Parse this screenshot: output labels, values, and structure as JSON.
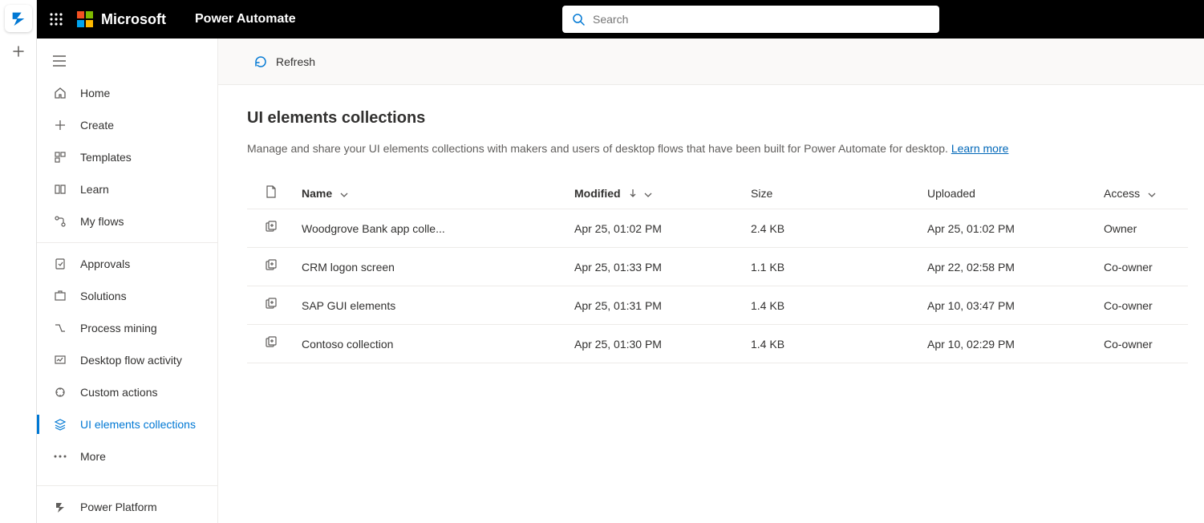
{
  "header": {
    "microsoft_label": "Microsoft",
    "product_label": "Power Automate",
    "search_placeholder": "Search"
  },
  "toolbar": {
    "refresh_label": "Refresh"
  },
  "sidebar": {
    "items": [
      {
        "label": "Home"
      },
      {
        "label": "Create"
      },
      {
        "label": "Templates"
      },
      {
        "label": "Learn"
      },
      {
        "label": "My flows"
      },
      {
        "label": "Approvals"
      },
      {
        "label": "Solutions"
      },
      {
        "label": "Process mining"
      },
      {
        "label": "Desktop flow activity"
      },
      {
        "label": "Custom actions"
      },
      {
        "label": "UI elements collections"
      },
      {
        "label": "More"
      }
    ],
    "footer": {
      "label": "Power Platform"
    }
  },
  "main": {
    "title": "UI elements collections",
    "description": "Manage and share your UI elements collections with makers and users of desktop flows that have been built for Power Automate for desktop. ",
    "learn_more_label": "Learn more",
    "columns": {
      "name": "Name",
      "modified": "Modified",
      "size": "Size",
      "uploaded": "Uploaded",
      "access": "Access"
    },
    "rows": [
      {
        "name": "Woodgrove Bank app colle...",
        "modified": "Apr 25, 01:02 PM",
        "size": "2.4 KB",
        "uploaded": "Apr 25, 01:02 PM",
        "access": "Owner"
      },
      {
        "name": "CRM logon screen",
        "modified": "Apr 25, 01:33 PM",
        "size": "1.1 KB",
        "uploaded": "Apr 22, 02:58 PM",
        "access": "Co-owner"
      },
      {
        "name": "SAP GUI elements",
        "modified": "Apr 25, 01:31 PM",
        "size": "1.4 KB",
        "uploaded": "Apr 10, 03:47 PM",
        "access": "Co-owner"
      },
      {
        "name": "Contoso collection",
        "modified": "Apr 25, 01:30 PM",
        "size": "1.4 KB",
        "uploaded": "Apr 10, 02:29 PM",
        "access": "Co-owner"
      }
    ]
  }
}
